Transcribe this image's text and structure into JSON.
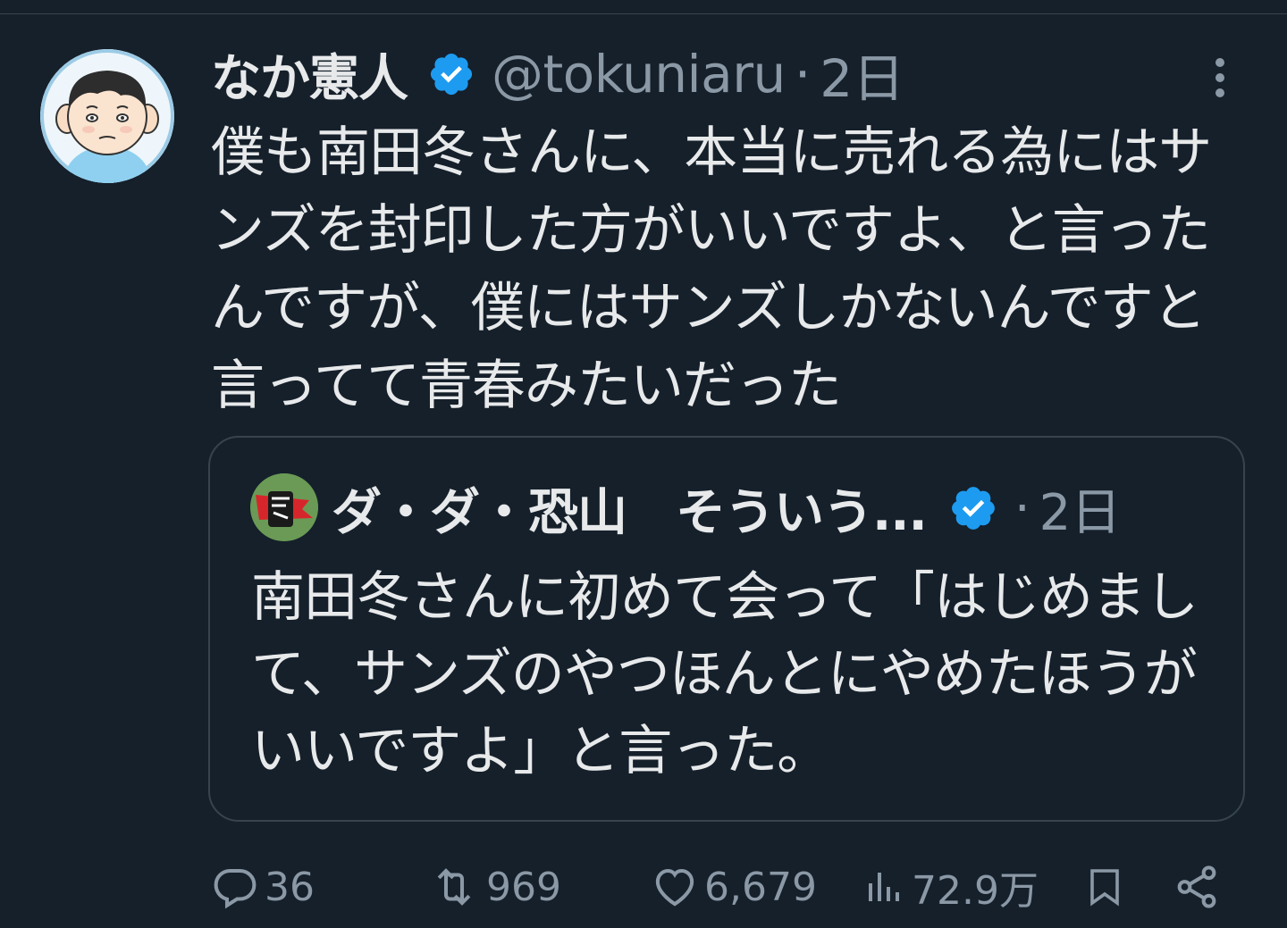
{
  "tweet": {
    "author_name": "なか憲人",
    "handle": "@tokuniaru",
    "separator": "·",
    "time": "2日",
    "text": "僕も南田冬さんに、本当に売れる為にはサンズを封印した方がいいですよ、と言ったんですが、僕にはサンズしかないんですと言ってて青春みたいだった"
  },
  "quote": {
    "author_name": "ダ・ダ・恐山　そういう...",
    "separator": "·",
    "time": "2日",
    "text": "南田冬さんに初めて会って「はじめまして、サンズのやつほんとにやめたほうがいいですよ」と言った。"
  },
  "actions": {
    "replies": "36",
    "retweets": "969",
    "likes": "6,679",
    "views": "72.9万"
  },
  "icons": {
    "more": "more-vertical-icon",
    "verified": "verified-badge-icon",
    "reply": "reply-icon",
    "retweet": "retweet-icon",
    "like": "heart-icon",
    "views": "views-chart-icon",
    "bookmark": "bookmark-icon",
    "share": "share-icon"
  },
  "colors": {
    "background": "#15202b",
    "text": "#e7e9ea",
    "secondary": "#8b98a5",
    "verified": "#1d9bf0",
    "border": "#38444d"
  }
}
